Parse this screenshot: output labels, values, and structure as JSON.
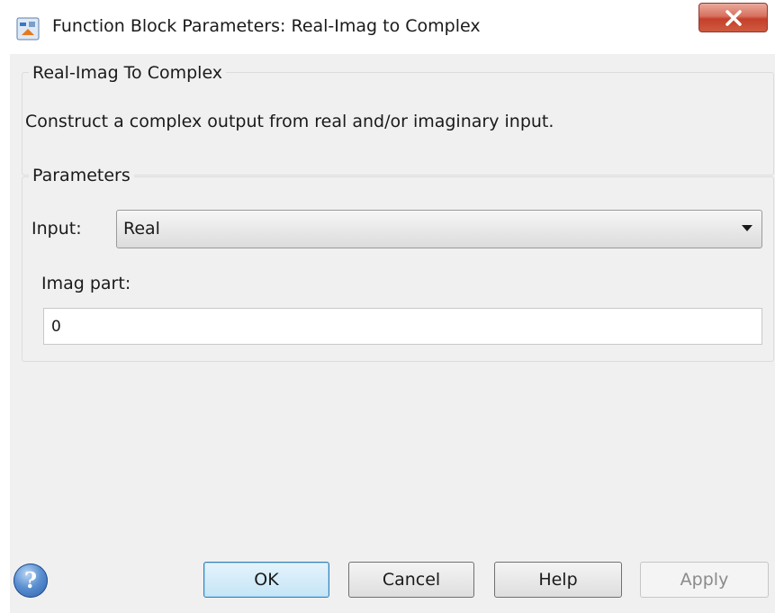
{
  "window": {
    "title": "Function Block Parameters: Real-Imag to Complex"
  },
  "description_group": {
    "legend": "Real-Imag To Complex",
    "text": "Construct a complex output from real and/or imaginary input."
  },
  "parameters_group": {
    "legend": "Parameters",
    "input_label": "Input:",
    "input_value": "Real",
    "imag_label": "Imag part:",
    "imag_value": "0"
  },
  "buttons": {
    "ok": "OK",
    "cancel": "Cancel",
    "help": "Help",
    "apply": "Apply"
  },
  "icons": {
    "app": "simulink-block-icon",
    "close": "close-icon",
    "help": "help-icon",
    "dropdown": "chevron-down-icon"
  },
  "colors": {
    "close_button": "#c4402b",
    "default_button": "#c4e5f6",
    "help_icon": "#2d5fa8"
  }
}
